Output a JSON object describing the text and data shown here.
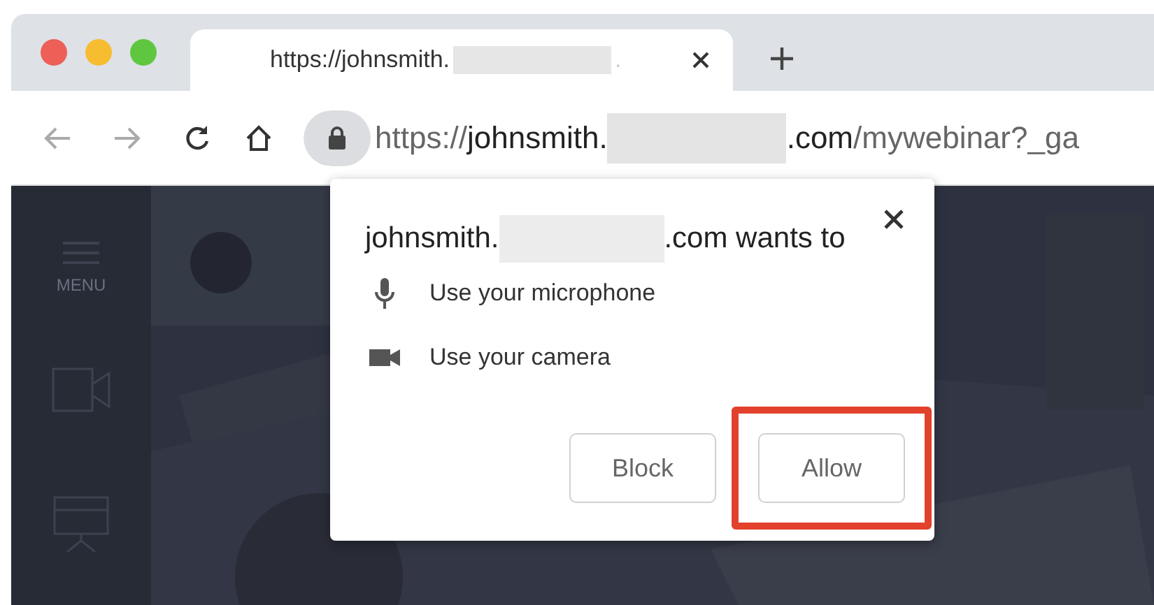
{
  "tab": {
    "title": "https://johnsmith.",
    "tail": "."
  },
  "toolbar": {
    "url_scheme": "https://",
    "url_host_start": "johnsmith.",
    "url_host_end": ".com",
    "url_path": "/mywebinar?_ga"
  },
  "sidebar": {
    "menu_label": "MENU"
  },
  "dialog": {
    "title_start": "johnsmith.",
    "title_end": ".com wants to",
    "permissions": [
      {
        "kind": "microphone",
        "label": "Use your microphone"
      },
      {
        "kind": "camera",
        "label": "Use your camera"
      }
    ],
    "buttons": [
      {
        "label": "Block",
        "highlighted": false
      },
      {
        "label": "Allow",
        "highlighted": true
      }
    ]
  }
}
